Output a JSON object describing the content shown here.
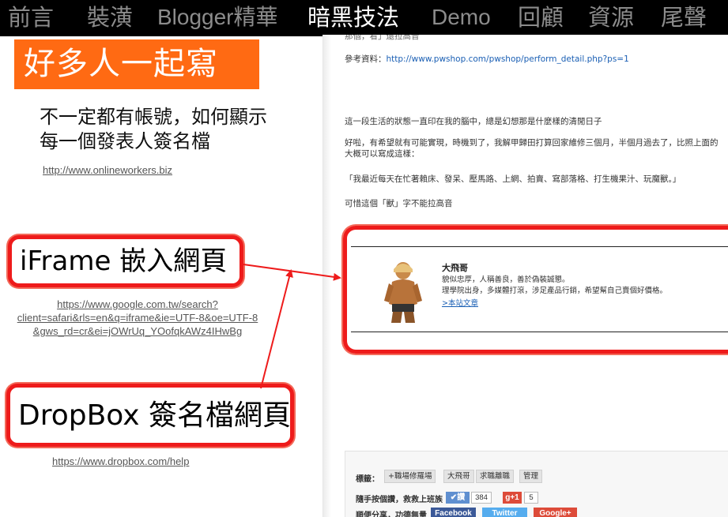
{
  "nav": {
    "items": [
      {
        "label": "前言",
        "active": false
      },
      {
        "label": "裝潢",
        "active": false
      },
      {
        "label": "Blogger精華",
        "active": false
      },
      {
        "label": "暗黑技法",
        "active": true
      },
      {
        "label": "Demo",
        "active": false
      },
      {
        "label": "回顧",
        "active": false
      },
      {
        "label": "資源",
        "active": false
      },
      {
        "label": "尾聲",
        "active": false
      }
    ]
  },
  "slide": {
    "title": "好多人一起寫",
    "description": [
      "不一定都有帳號，如何顯示",
      "每一個發表人簽名檔"
    ],
    "link_onlineworkers": "http://www.onlineworkers.biz",
    "callout_iframe": "iFrame 嵌入網頁",
    "link_google": [
      "https://www.google.com.tw/search?",
      "client=safari&rls=en&q=iframe&ie=UTF-8&oe=UTF-8",
      "&gws_rd=cr&ei=jOWrUq_YOofqkAWz4IHwBg"
    ],
    "callout_dropbox": "DropBox 簽名檔網頁",
    "link_dropbox": "https://www.dropbox.com/help"
  },
  "blog": {
    "cropped_top": "那個，看」還拉高音",
    "ref_label": "參考資料：",
    "ref_url": "http://www.pwshop.com/pwshop/perform_detail.php?ps=1",
    "para1": "這一段生活的狀態一直印在我的腦中，總是幻想那是什麼樣的清閒日子",
    "para2a": "好啦，有希望就有可能實現，時機到了，我解甲歸田打算回家維修三個月，半個月過去了，比照上面的",
    "para2b": "大概可以寫成這樣：",
    "para3": "「我最近每天在忙著賴床、發呆、壓馬路、上網、拍賣、寫部落格、打生機果汁、玩魔獸。」",
    "para4": "可惜這個「獸」字不能拉高音",
    "signature": {
      "name": "大飛哥",
      "line1": "貌似忠厚，人稱善良，善於偽裝誠懇。",
      "line2": "理學院出身，多媒體打滾，涉足產品行銷，希望幫自己賣個好價格。",
      "link": ">本站文章"
    },
    "footer": {
      "tags_label": "標籤：",
      "tags": [
        "+職場修羅場",
        "大飛哥",
        "求職離職",
        "管理"
      ],
      "subscribe_label": "隨手按個讚，救救上班族",
      "like_button": "讚",
      "like_count": "384",
      "gplus_button": "+1",
      "gplus_count": "5",
      "share_label": "順便分享，功德無量",
      "share_buttons": [
        "Facebook",
        "Twitter",
        "Google+"
      ]
    }
  },
  "colors": {
    "nav_bg": "#000000",
    "nav_inactive": "#8c8c8c",
    "nav_active": "#ffffff",
    "title_bg": "#ff6a13",
    "callout_red": "#ee1b1b",
    "facebook": "#3b5998",
    "twitter": "#55acee",
    "gplus": "#dd4b39"
  }
}
